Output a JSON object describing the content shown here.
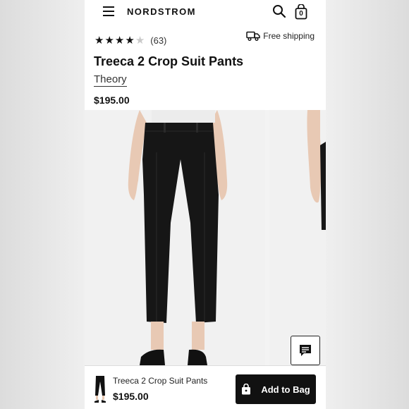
{
  "header": {
    "logo": "NORDSTROM",
    "bag_count": "0"
  },
  "product": {
    "rating": 4,
    "rating_max": 5,
    "review_count": "(63)",
    "shipping_label": "Free shipping",
    "title": "Treeca 2 Crop Suit Pants",
    "brand": "Theory",
    "price": "$195.00"
  },
  "bottom_bar": {
    "title": "Treeca 2 Crop Suit Pants",
    "price": "$195.00",
    "add_to_bag_label": "Add to Bag"
  },
  "icons": {
    "menu": "hamburger-menu-icon",
    "search": "search-icon",
    "bag": "shopping-bag-icon",
    "truck": "truck-icon",
    "chat": "chat-icon"
  }
}
